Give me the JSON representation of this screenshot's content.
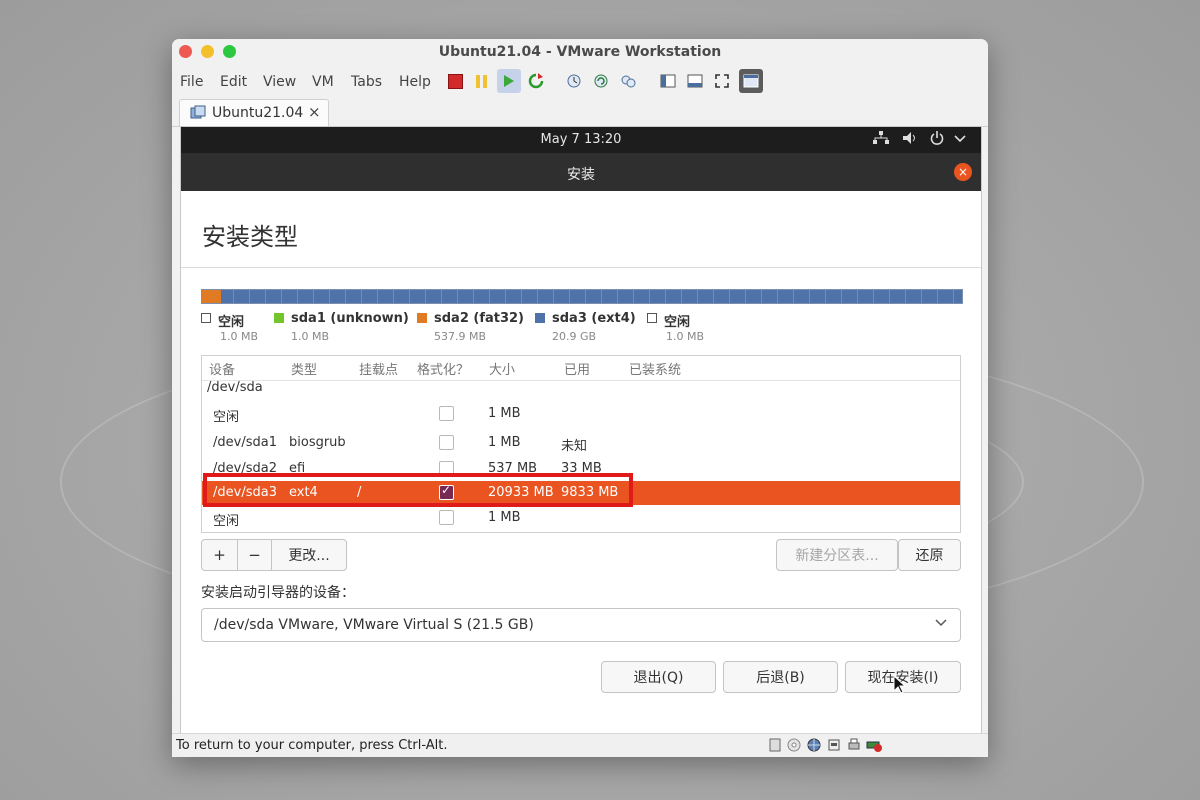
{
  "window": {
    "title": "Ubuntu21.04 - VMware Workstation",
    "menu": [
      "File",
      "Edit",
      "View",
      "VM",
      "Tabs",
      "Help"
    ],
    "toolbar_icons": [
      "power-stop-icon",
      "pause-icon",
      "play-icon",
      "refresh-icon",
      "snapshot-icon",
      "revert-snapshot-icon",
      "snapshot-manager-icon",
      "sidebar-toggle-icon",
      "console-view-icon",
      "fullscreen-icon",
      "unity-icon"
    ]
  },
  "tab": {
    "label": "Ubuntu21.04",
    "close": "×"
  },
  "gnome": {
    "clock": "May 7  13:20"
  },
  "installer": {
    "window_title": "安装",
    "close": "×",
    "page_title": "安装类型",
    "legend": [
      {
        "name": "空闲",
        "size": "1.0 MB",
        "color": "#ffffff"
      },
      {
        "name": "sda1 (unknown)",
        "size": "1.0 MB",
        "color": "#73c52b"
      },
      {
        "name": "sda2 (fat32)",
        "size": "537.9 MB",
        "color": "#e07b24"
      },
      {
        "name": "sda3 (ext4)",
        "size": "20.9 GB",
        "color": "#4f72a9"
      },
      {
        "name": "空闲",
        "size": "1.0 MB",
        "color": "#ffffff"
      }
    ],
    "table": {
      "headers": [
        "设备",
        "类型",
        "挂载点",
        "格式化？",
        "大小",
        "已用",
        "已装系统"
      ],
      "device_group": "/dev/sda",
      "rows": [
        {
          "device": "空闲",
          "type": "",
          "mount": "",
          "size": "1 MB",
          "used": "",
          "checked": false
        },
        {
          "device": "/dev/sda1",
          "type": "biosgrub",
          "mount": "",
          "size": "1 MB",
          "used": "未知",
          "checked": false
        },
        {
          "device": "/dev/sda2",
          "type": "efi",
          "mount": "",
          "size": "537 MB",
          "used": "33 MB",
          "checked": false
        },
        {
          "device": "/dev/sda3",
          "type": "ext4",
          "mount": "/",
          "size": "20933 MB",
          "used": "9833 MB",
          "checked": true
        },
        {
          "device": "空闲",
          "type": "",
          "mount": "",
          "size": "1 MB",
          "used": "",
          "checked": false
        }
      ]
    },
    "buttons": {
      "add": "+",
      "remove": "−",
      "change": "更改...",
      "new_table": "新建分区表...",
      "revert": "还原",
      "quit": "退出(Q)",
      "back": "后退(B)",
      "install_now": "现在安装(I)"
    },
    "boot_loader_label": "安装启动引导器的设备：",
    "boot_loader_value": "/dev/sda   VMware, VMware Virtual S (21.5 GB)"
  },
  "statusbar": {
    "text": "To return to your computer, press Ctrl-Alt."
  },
  "colors": {
    "ubuntu_orange": "#e95420",
    "ubuntu_purple": "#772953",
    "highlight_red": "#e01919"
  }
}
